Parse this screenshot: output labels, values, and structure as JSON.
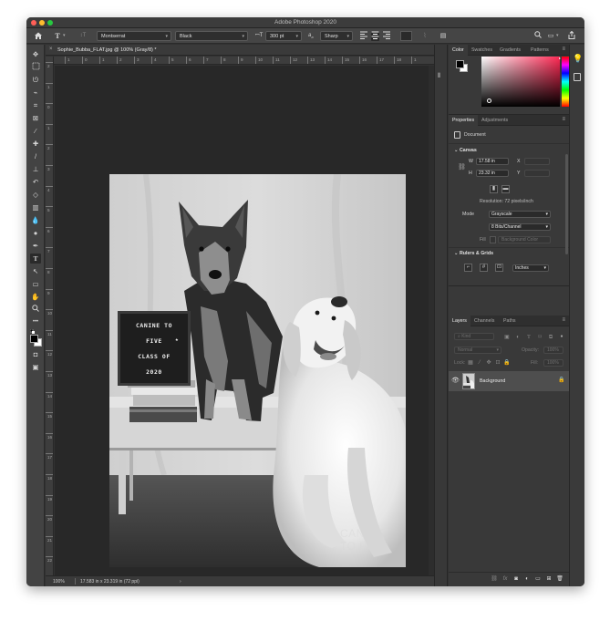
{
  "window": {
    "title": "Adobe Photoshop 2020"
  },
  "options_bar": {
    "font_family": "Montserrat",
    "font_style": "Black",
    "font_size": "300 pt",
    "antialias_label": "a",
    "antialias": "Sharp"
  },
  "document": {
    "tab_title": "Sophie_Bubba_FLAT.jpg @ 100% (Gray/8) *",
    "zoom": "100%",
    "doc_info": "17.583 in x 23.319 in (72 ppi)",
    "ruler_h": [
      "1",
      "0",
      "1",
      "2",
      "3",
      "4",
      "5",
      "6",
      "7",
      "8",
      "9",
      "10",
      "11",
      "12",
      "13",
      "14",
      "15",
      "16",
      "17",
      "18",
      "1"
    ],
    "ruler_v": [
      "2",
      "1",
      "0",
      "1",
      "2",
      "3",
      "4",
      "5",
      "6",
      "7",
      "8",
      "9",
      "10",
      "11",
      "12",
      "13",
      "14",
      "15",
      "16",
      "17",
      "18",
      "19",
      "20",
      "21",
      "22",
      "23"
    ]
  },
  "photo": {
    "board_lines": [
      "CANINE TO",
      "FIVE",
      "CLASS OF",
      "2020"
    ],
    "board_star": "★",
    "watermark_line1": "CANINE",
    "watermark_line2": "TO FIVE"
  },
  "color_panel": {
    "tabs": [
      "Color",
      "Swatches",
      "Gradients",
      "Patterns"
    ]
  },
  "properties_panel": {
    "tabs": [
      "Properties",
      "Adjustments"
    ],
    "document_label": "Document",
    "canvas_label": "Canvas",
    "w_label": "W",
    "w_value": "17.58 in",
    "x_label": "X",
    "h_label": "H",
    "h_value": "23.32 in",
    "y_label": "Y",
    "resolution": "Resolution: 72 pixels/inch",
    "mode_label": "Mode",
    "mode_value": "Grayscale",
    "bits_value": "8 Bits/Channel",
    "fill_label": "Fill",
    "fill_value": "Background Color",
    "rulers_label": "Rulers & Grids",
    "units_value": "Inches"
  },
  "layers_panel": {
    "tabs": [
      "Layers",
      "Channels",
      "Paths"
    ],
    "kind_placeholder": "Kind",
    "blend_mode": "Normal",
    "opacity_label": "Opacity:",
    "opacity_value": "100%",
    "lock_label": "Lock:",
    "fill_label": "Fill:",
    "fill_value": "100%",
    "layer_name": "Background"
  },
  "colors": {
    "accent": "#1473e6",
    "panel_bg": "#393939",
    "pasteboard": "#282828",
    "color_field_hue": "#ff2a55"
  },
  "icons": {
    "home": "home-icon",
    "type_tool": "type-tool-icon",
    "search": "search-icon",
    "share": "share-icon",
    "lightbulb": "learn-icon",
    "libraries": "libraries-icon"
  }
}
